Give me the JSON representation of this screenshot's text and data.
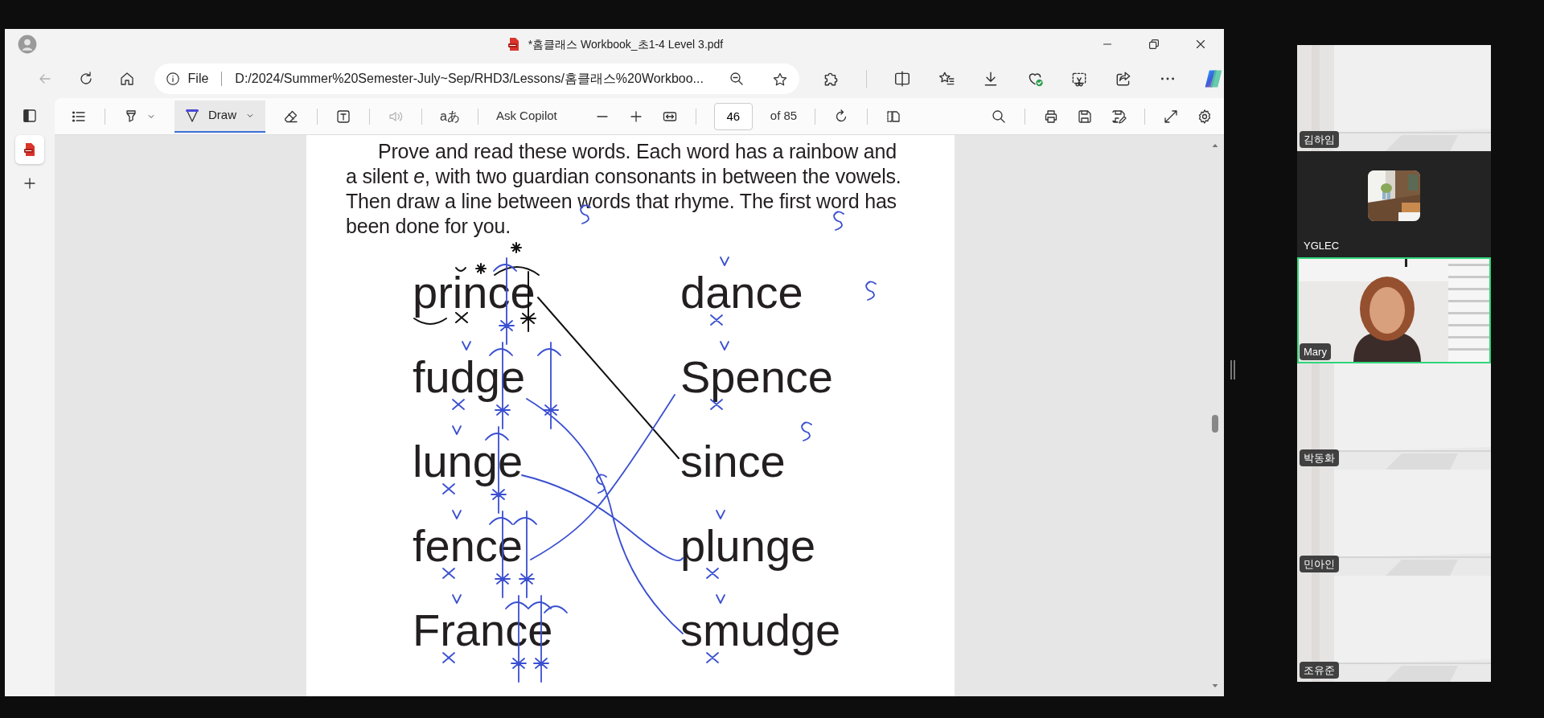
{
  "window": {
    "title": "*홈클래스 Workbook_초1-4 Level 3.pdf"
  },
  "back_button": {
    "disabled": true
  },
  "address_bar": {
    "scheme": "File",
    "url": "D:/2024/Summer%20Semester-July~Sep/RHD3/Lessons/홈클래스%20Workboo..."
  },
  "pdf_toolbar": {
    "draw": {
      "label": "Draw",
      "selected": true
    },
    "read_aloud": {
      "disabled": true
    },
    "translate": "aあ",
    "ask": "Ask Copilot",
    "page": "46",
    "page_count": "of 85"
  },
  "sidebar_tabs": [
    {
      "kind": "pdf",
      "selected": true
    }
  ],
  "document": {
    "instructions": "Prove and read these words. Each word has a rainbow and a silent *e*, with two guardian consonants in between the vowels. Then draw a line between words that rhyme. The first word has been done for you.",
    "left_words": [
      "prince",
      "fudge",
      "lunge",
      "fence",
      "France"
    ],
    "right_words": [
      "dance",
      "Spence",
      "since",
      "plunge",
      "smudge"
    ]
  },
  "participants": [
    {
      "name": "김하임",
      "kind": "camera",
      "speaking": false
    },
    {
      "name": "YGLEC",
      "kind": "avatar",
      "speaking": false
    },
    {
      "name": "Mary",
      "kind": "person",
      "speaking": true
    },
    {
      "name": "박동화",
      "kind": "camera",
      "speaking": false
    },
    {
      "name": "민아인",
      "kind": "camera",
      "speaking": false
    },
    {
      "name": "조유준",
      "kind": "camera",
      "speaking": false
    }
  ]
}
